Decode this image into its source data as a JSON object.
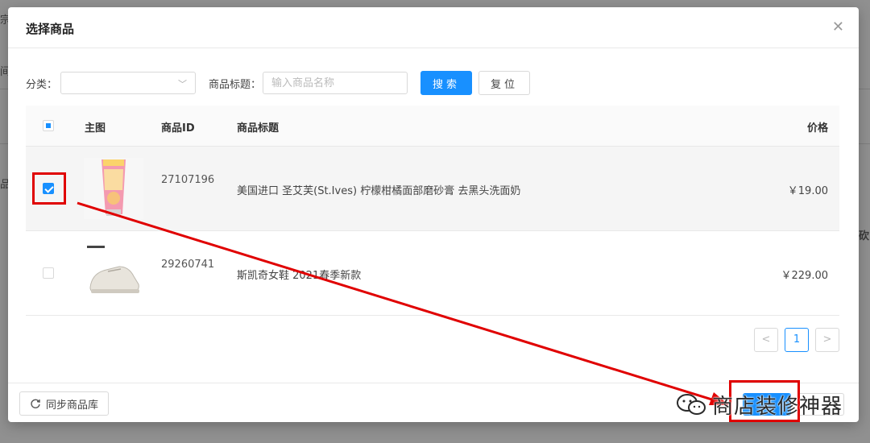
{
  "background": {
    "frag_left_1": "宗",
    "frag_left_2": "间",
    "frag_left_3": "品",
    "frag_right": "砍"
  },
  "modal": {
    "title": "选择商品",
    "close_icon": "close-icon"
  },
  "filters": {
    "category_label": "分类：",
    "category_value": "",
    "title_label": "商品标题：",
    "title_placeholder": "输入商品名称",
    "title_value": "",
    "search_label": "搜索",
    "reset_label": "复位"
  },
  "table": {
    "headers": {
      "image": "主图",
      "id": "商品ID",
      "title": "商品标题",
      "price": "价格"
    },
    "rows": [
      {
        "checked": true,
        "id": "27107196",
        "title": "美国进口 圣艾芙(St.Ives) 柠檬柑橘面部磨砂膏 去黑头洗面奶",
        "price": "￥19.00"
      },
      {
        "checked": false,
        "id": "29260741",
        "title": "斯凯奇女鞋 2021春季新款",
        "price": "￥229.00"
      }
    ]
  },
  "pagination": {
    "prev": "<",
    "current": "1",
    "next": ">"
  },
  "footer": {
    "sync_label": "同步商品库",
    "confirm_label": ""
  },
  "watermark": {
    "text": "商店装修神器"
  },
  "colors": {
    "primary": "#1890ff",
    "highlight": "#e00000"
  }
}
